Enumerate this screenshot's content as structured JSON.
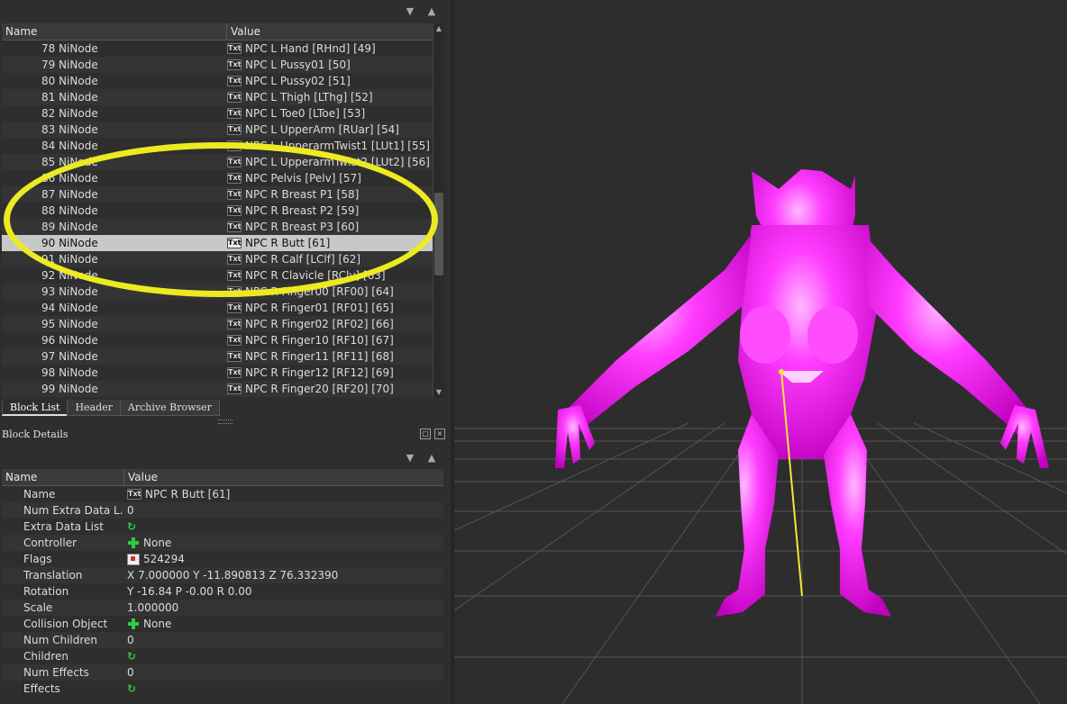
{
  "block_list": {
    "columns": [
      "Name",
      "Value"
    ],
    "rows": [
      {
        "name": "78 NiNode",
        "value": "NPC L Hand [RHnd] [49]"
      },
      {
        "name": "79 NiNode",
        "value": "NPC L Pussy01 [50]"
      },
      {
        "name": "80 NiNode",
        "value": "NPC L Pussy02 [51]"
      },
      {
        "name": "81 NiNode",
        "value": "NPC L Thigh [LThg] [52]"
      },
      {
        "name": "82 NiNode",
        "value": "NPC L Toe0 [LToe] [53]"
      },
      {
        "name": "83 NiNode",
        "value": "NPC L UpperArm [RUar] [54]"
      },
      {
        "name": "84 NiNode",
        "value": "NPC L UpperarmTwist1 [LUt1] [55]"
      },
      {
        "name": "85 NiNode",
        "value": "NPC L UpperarmTwist2 [LUt2] [56]"
      },
      {
        "name": "86 NiNode",
        "value": "NPC Pelvis [Pelv] [57]"
      },
      {
        "name": "87 NiNode",
        "value": "NPC R Breast P1 [58]"
      },
      {
        "name": "88 NiNode",
        "value": "NPC R Breast P2 [59]"
      },
      {
        "name": "89 NiNode",
        "value": "NPC R Breast P3 [60]"
      },
      {
        "name": "90 NiNode",
        "value": "NPC R Butt [61]"
      },
      {
        "name": "91 NiNode",
        "value": "NPC R Calf [LClf] [62]"
      },
      {
        "name": "92 NiNode",
        "value": "NPC R Clavicle [RClv] [63]"
      },
      {
        "name": "93 NiNode",
        "value": "NPC R Finger00 [RF00] [64]"
      },
      {
        "name": "94 NiNode",
        "value": "NPC R Finger01 [RF01] [65]"
      },
      {
        "name": "95 NiNode",
        "value": "NPC R Finger02 [RF02] [66]"
      },
      {
        "name": "96 NiNode",
        "value": "NPC R Finger10 [RF10] [67]"
      },
      {
        "name": "97 NiNode",
        "value": "NPC R Finger11 [RF11] [68]"
      },
      {
        "name": "98 NiNode",
        "value": "NPC R Finger12 [RF12] [69]"
      },
      {
        "name": "99 NiNode",
        "value": "NPC R Finger20 [RF20] [70]"
      }
    ],
    "selected_name": "90 NiNode",
    "value_icon": "Txt"
  },
  "tabs": [
    "Block List",
    "Header",
    "Archive Browser"
  ],
  "block_details": {
    "title": "Block Details",
    "columns": [
      "Name",
      "Value"
    ],
    "rows": [
      {
        "name": "Name",
        "value": "NPC R Butt [61]",
        "icon": "txt-icon"
      },
      {
        "name": "Num Extra Data L...",
        "value": "0",
        "icon": ""
      },
      {
        "name": "Extra Data List",
        "value": "",
        "icon": "cycle-icon"
      },
      {
        "name": "Controller",
        "value": "None",
        "icon": "plus-icon"
      },
      {
        "name": "Flags",
        "value": "524294",
        "icon": "flag-icon"
      },
      {
        "name": "Translation",
        "value": "X 7.000000 Y -11.890813 Z 76.332390",
        "icon": ""
      },
      {
        "name": "Rotation",
        "value": "Y -16.84 P -0.00 R 0.00",
        "icon": ""
      },
      {
        "name": "Scale",
        "value": "1.000000",
        "icon": ""
      },
      {
        "name": "Collision Object",
        "value": "None",
        "icon": "plus-icon"
      },
      {
        "name": "Num Children",
        "value": "0",
        "icon": ""
      },
      {
        "name": "Children",
        "value": "",
        "icon": "cycle-icon"
      },
      {
        "name": "Num Effects",
        "value": "0",
        "icon": ""
      },
      {
        "name": "Effects",
        "value": "",
        "icon": "cycle-icon"
      }
    ]
  },
  "colors": {
    "highlight_ellipse": "#ecea22",
    "model": "#ff22ff",
    "bone_line": "#f0ea30"
  }
}
